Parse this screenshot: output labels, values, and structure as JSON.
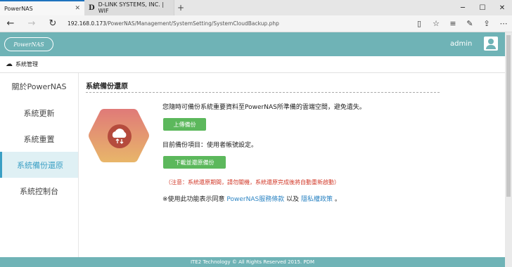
{
  "browser": {
    "tabs": [
      {
        "title": "PowerNAS",
        "active": true
      },
      {
        "title": "D-LINK SYSTEMS, INC. | WIF",
        "active": false
      }
    ],
    "url_host": "192.168.0.173",
    "url_path": "/PowerNAS/Management/SystemSetting/SystemCloudBackup.php"
  },
  "header": {
    "logo_text": "PowerNAS",
    "user": "admin"
  },
  "breadcrumb": "系統管理",
  "sidebar": {
    "items": [
      {
        "label": "關於PowerNAS"
      },
      {
        "label": "系統更新"
      },
      {
        "label": "系統重置"
      },
      {
        "label": "系統備份還原"
      },
      {
        "label": "系統控制台"
      }
    ]
  },
  "main": {
    "title": "系統備份還原",
    "description": "您隨時可備份系統重要資料至PowerNAS所準備的雲端空間，避免遺失。",
    "upload_button": "上傳備份",
    "current_backup": "目前備份項目：使用者帳號設定。",
    "restore_button": "下載並還原備份",
    "warning": "（注意：系統還原期間，請勿關機，系統還原完成後將自動重新啟動）",
    "agree_prefix": "※使用此功能表示同意",
    "terms_link": "PowerNAS服務條款",
    "agree_and": "以及",
    "privacy_link": "隱私權政策",
    "agree_suffix": "。"
  },
  "footer": "ITE2 Technology © All Rights Reserved 2015. PDM",
  "colors": {
    "header": "#6fb3b6",
    "active_side": "#3a9fc4",
    "button": "#5cb85c",
    "warning": "#d23a2a"
  }
}
